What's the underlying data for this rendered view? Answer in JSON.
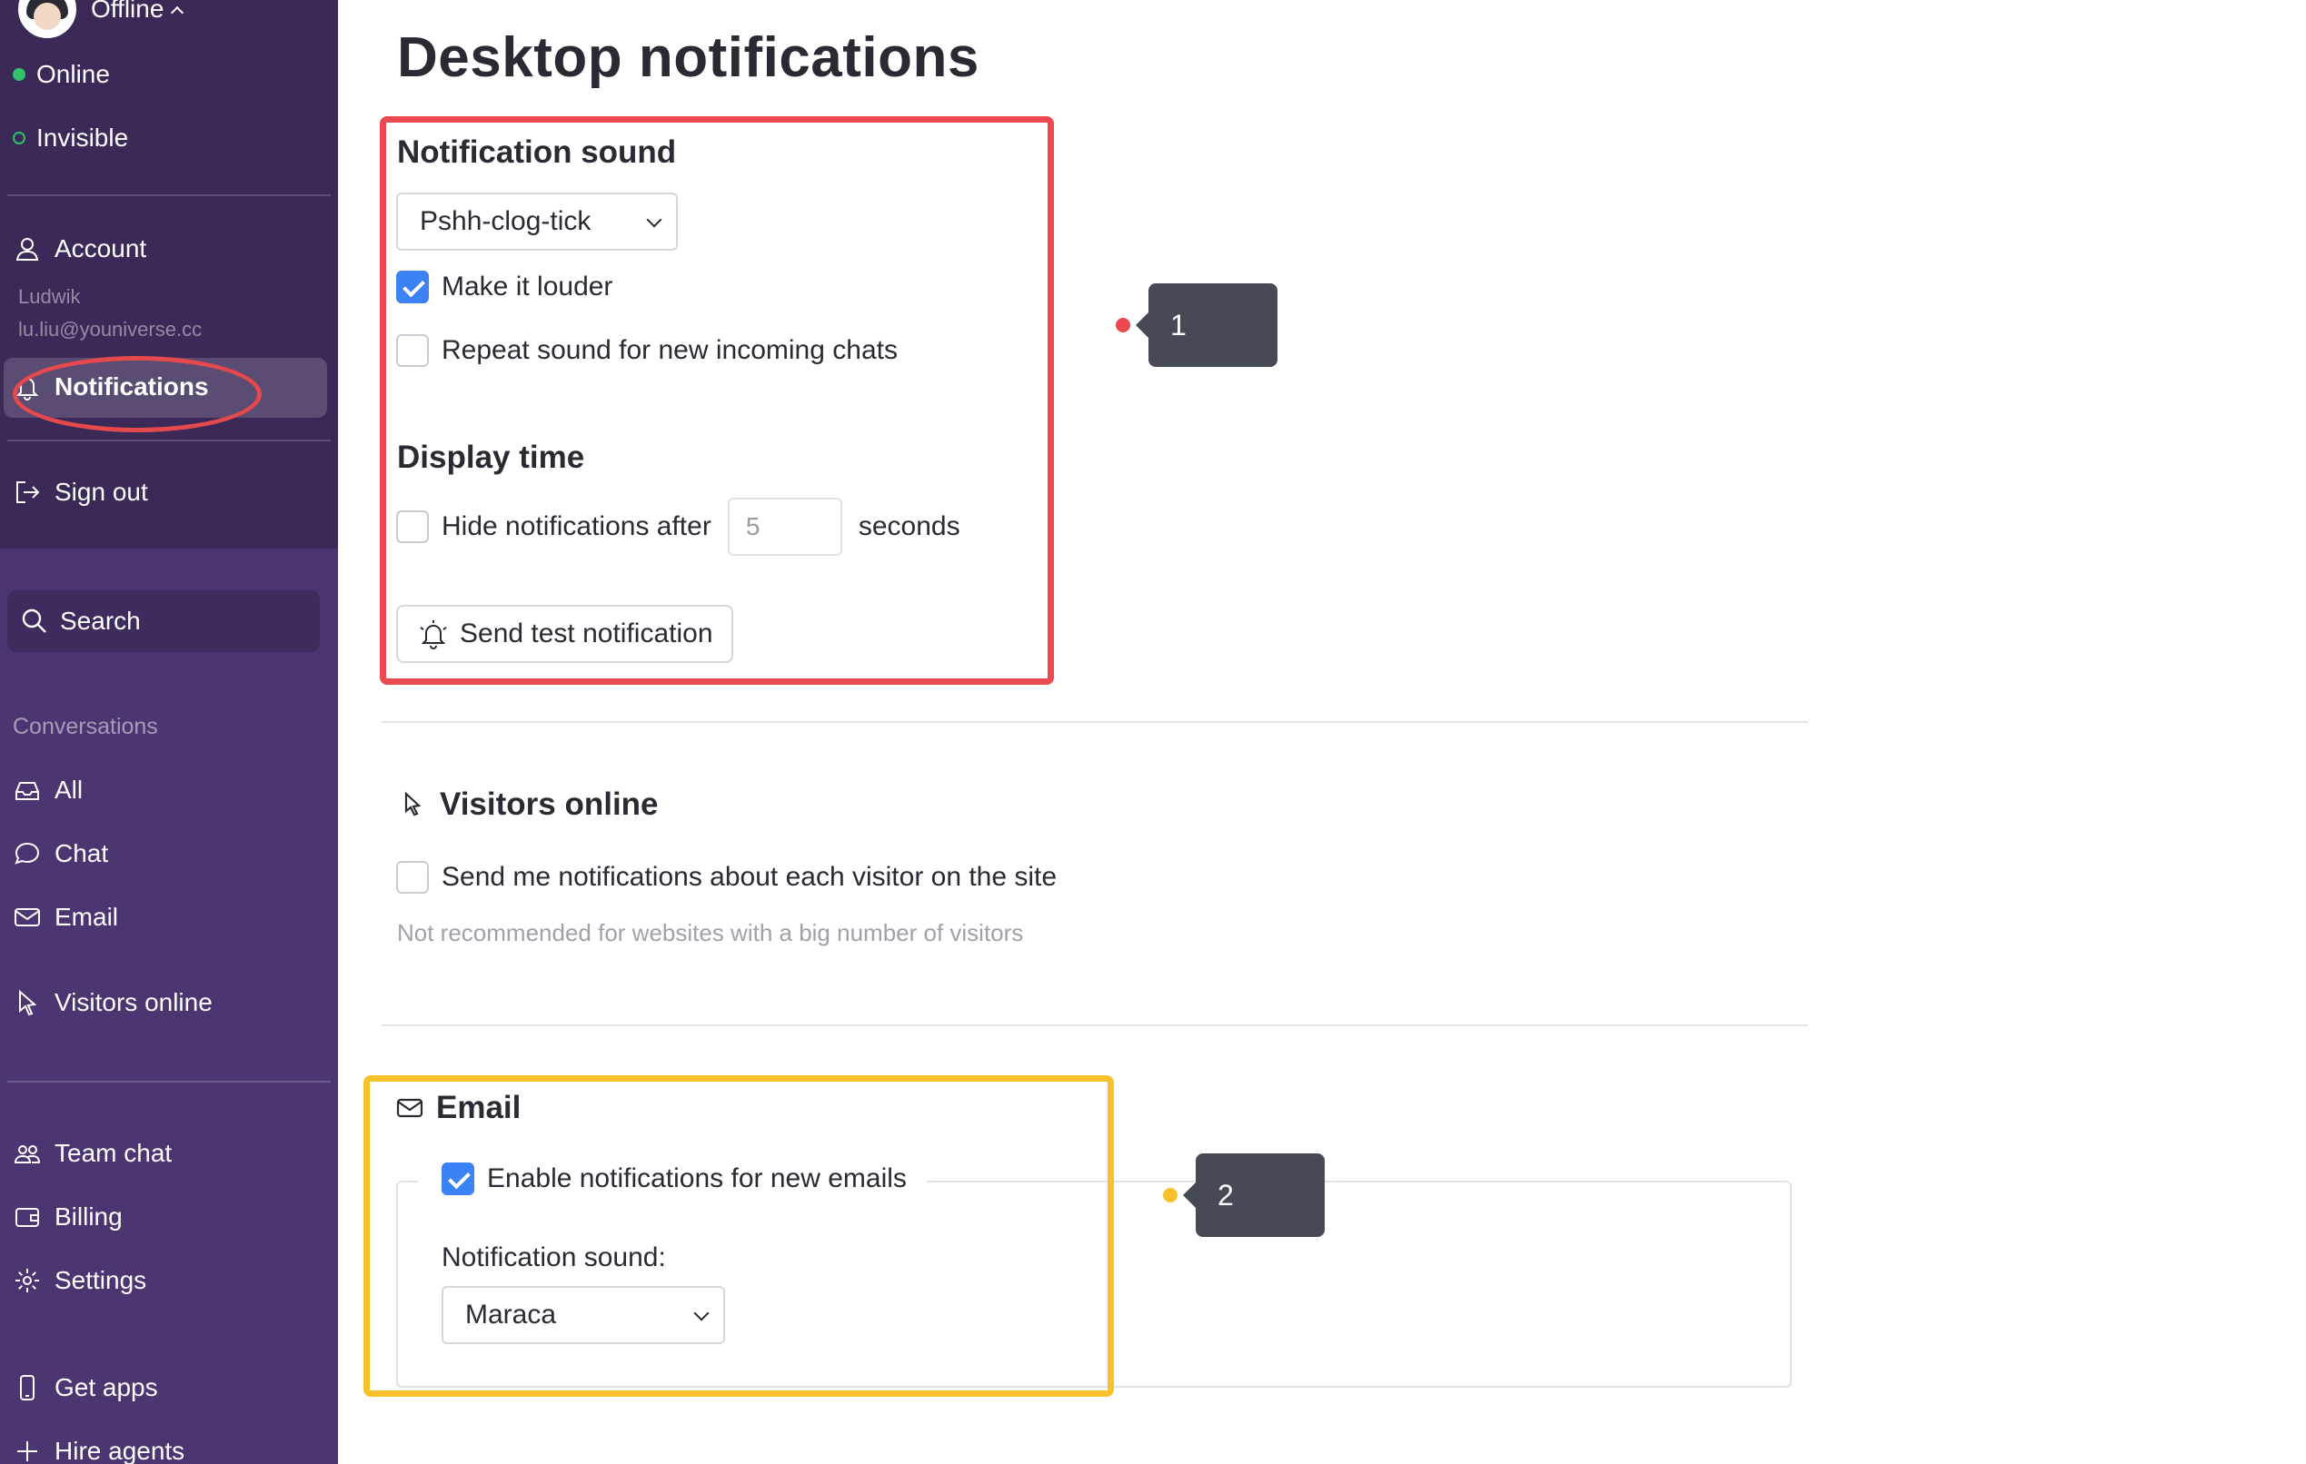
{
  "sidebar": {
    "status": "Offline",
    "status_options": [
      "Online",
      "Invisible"
    ],
    "account": {
      "label": "Account",
      "name": "Ludwik",
      "email": "lu.liu@youniverse.cc"
    },
    "notifications_label": "Notifications",
    "sign_out_label": "Sign out",
    "search_label": "Search",
    "conversations_heading": "Conversations",
    "conversations": [
      "All",
      "Chat",
      "Email"
    ],
    "visitors_label": "Visitors online",
    "team_chat_label": "Team chat",
    "billing_label": "Billing",
    "settings_label": "Settings",
    "get_apps_label": "Get apps",
    "hire_agents_label": "Hire agents"
  },
  "page": {
    "title": "Desktop notifications",
    "notification_sound": {
      "heading": "Notification sound",
      "selected": "Pshh-clog-tick",
      "louder_label": "Make it louder",
      "louder_checked": true,
      "repeat_label": "Repeat sound for new incoming chats",
      "repeat_checked": false
    },
    "display_time": {
      "heading": "Display time",
      "hide_label": "Hide notifications after",
      "hide_checked": false,
      "seconds_placeholder": "5",
      "seconds_label": "seconds"
    },
    "test_button": "Send test notification",
    "visitors": {
      "heading": "Visitors online",
      "notify_label": "Send me notifications about each visitor on the site",
      "notify_checked": false,
      "hint": "Not recommended for websites with a big number of visitors"
    },
    "email": {
      "heading": "Email",
      "enable_label": "Enable notifications for new emails",
      "enable_checked": true,
      "sound_label": "Notification sound:",
      "sound_selected": "Maraca"
    }
  },
  "callouts": [
    "1",
    "2"
  ],
  "colors": {
    "sidebar": "#3b2a58",
    "accent_check": "#3b82f6",
    "red_annotation": "#ea4a4f",
    "yellow_annotation": "#f8c22a",
    "online": "#31c26e"
  }
}
